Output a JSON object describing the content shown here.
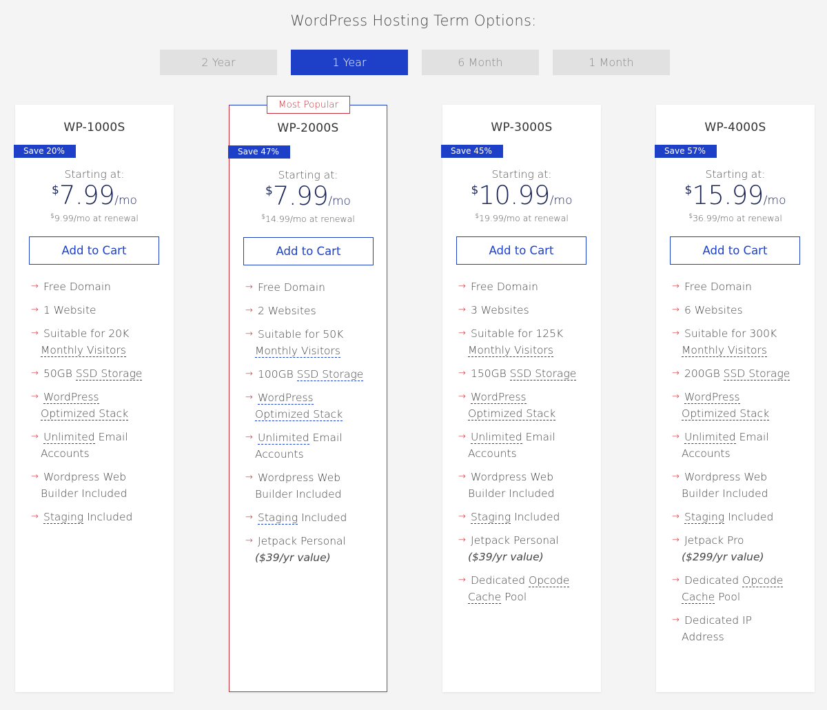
{
  "heading": "WordPress Hosting Term Options:",
  "terms": [
    "2 Year",
    "1 Year",
    "6 Month",
    "1 Month"
  ],
  "active_term": "1 Year",
  "colors": {
    "accent": "#1e40c8",
    "red": "#c8313c",
    "price": "#1a2456"
  },
  "icons": {
    "feature_bullet": "arrow-right-icon"
  },
  "plans": [
    {
      "name": "WP-1000S",
      "save": "Save 20%",
      "starting": "Starting at:",
      "currency": "$",
      "price": "7.99",
      "per": "/mo",
      "renewal": "9.99/mo at renewal",
      "cart": "Add to Cart",
      "features": [
        [
          "Free Domain"
        ],
        [
          "1 Website"
        ],
        [
          "Suitable for 20K",
          "Monthly Visitors"
        ],
        [
          "50GB ",
          "SSD Storage"
        ],
        [
          "WordPress",
          "Optimized Stack"
        ],
        [
          "Unlimited",
          " Email",
          "Accounts"
        ],
        [
          "Wordpress Web",
          "Builder Included"
        ],
        [
          "Staging",
          " Included"
        ]
      ]
    },
    {
      "name": "WP-2000S",
      "popular": "Most Popular",
      "save": "Save 47%",
      "starting": "Starting at:",
      "currency": "$",
      "price": "7.99",
      "per": "/mo",
      "renewal": "14.99/mo at renewal",
      "cart": "Add to Cart",
      "features": [
        [
          "Free Domain"
        ],
        [
          "2 Websites"
        ],
        [
          "Suitable for 50K",
          "Monthly Visitors"
        ],
        [
          "100GB ",
          "SSD Storage"
        ],
        [
          "WordPress",
          "Optimized Stack"
        ],
        [
          "Unlimited",
          " Email",
          "Accounts"
        ],
        [
          "Wordpress Web",
          "Builder Included"
        ],
        [
          "Staging",
          " Included"
        ],
        [
          "Jetpack Personal",
          "($39/yr value)"
        ]
      ]
    },
    {
      "name": "WP-3000S",
      "save": "Save 45%",
      "starting": "Starting at:",
      "currency": "$",
      "price": "10.99",
      "per": "/mo",
      "renewal": "19.99/mo at renewal",
      "cart": "Add to Cart",
      "features": [
        [
          "Free Domain"
        ],
        [
          "3 Websites"
        ],
        [
          "Suitable for 125K",
          "Monthly Visitors"
        ],
        [
          "150GB ",
          "SSD Storage"
        ],
        [
          "WordPress",
          "Optimized Stack"
        ],
        [
          "Unlimited",
          " Email",
          "Accounts"
        ],
        [
          "Wordpress Web",
          "Builder Included"
        ],
        [
          "Staging",
          " Included"
        ],
        [
          "Jetpack Personal",
          "($39/yr value)"
        ],
        [
          "Dedicated ",
          "Opcode",
          "Cache",
          " Pool"
        ]
      ]
    },
    {
      "name": "WP-4000S",
      "save": "Save 57%",
      "starting": "Starting at:",
      "currency": "$",
      "price": "15.99",
      "per": "/mo",
      "renewal": "36.99/mo at renewal",
      "cart": "Add to Cart",
      "features": [
        [
          "Free Domain"
        ],
        [
          "6 Websites"
        ],
        [
          "Suitable for 300K",
          "Monthly Visitors"
        ],
        [
          "200GB ",
          "SSD Storage"
        ],
        [
          "WordPress",
          "Optimized Stack"
        ],
        [
          "Unlimited",
          " Email",
          "Accounts"
        ],
        [
          "Wordpress Web",
          "Builder Included"
        ],
        [
          "Staging",
          " Included"
        ],
        [
          "Jetpack Pro",
          "($299/yr value)"
        ],
        [
          "Dedicated ",
          "Opcode",
          "Cache",
          " Pool"
        ],
        [
          "Dedicated IP",
          "Address"
        ]
      ]
    }
  ]
}
